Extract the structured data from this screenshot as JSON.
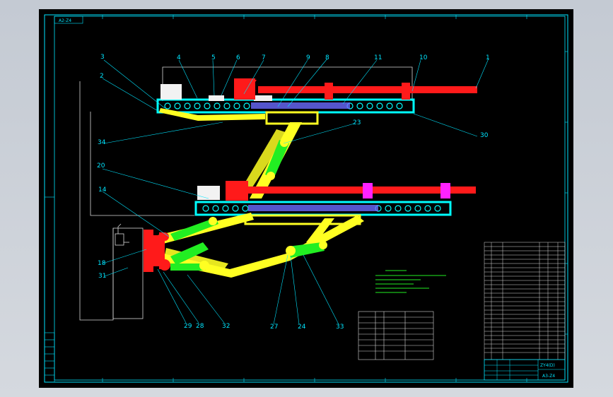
{
  "drawing": {
    "sheet_code": "A2-Z4",
    "part_labels": {
      "p1": "1",
      "p2": "2",
      "p3": "3",
      "p4": "4",
      "p5": "5",
      "p6": "6",
      "p7": "7",
      "p8": "8",
      "p9": "9",
      "p10": "10",
      "p11": "11",
      "p14": "14",
      "p18": "18",
      "p20": "20",
      "p23": "23",
      "p24": "24",
      "p27": "27",
      "p28": "28",
      "p29": "29",
      "p30": "30",
      "p31": "31",
      "p32": "32",
      "p33": "33",
      "p34": "34"
    },
    "title_block": {
      "name": "ZY4(D)",
      "code": "A3-Z4"
    },
    "colors": {
      "conveyor": "#00ffff",
      "boom": "#ff1a1a",
      "arm": "#ffff22",
      "cylinder": "#22ee22",
      "clamp": "#ff22ff",
      "outline": "#00e5ff"
    }
  }
}
